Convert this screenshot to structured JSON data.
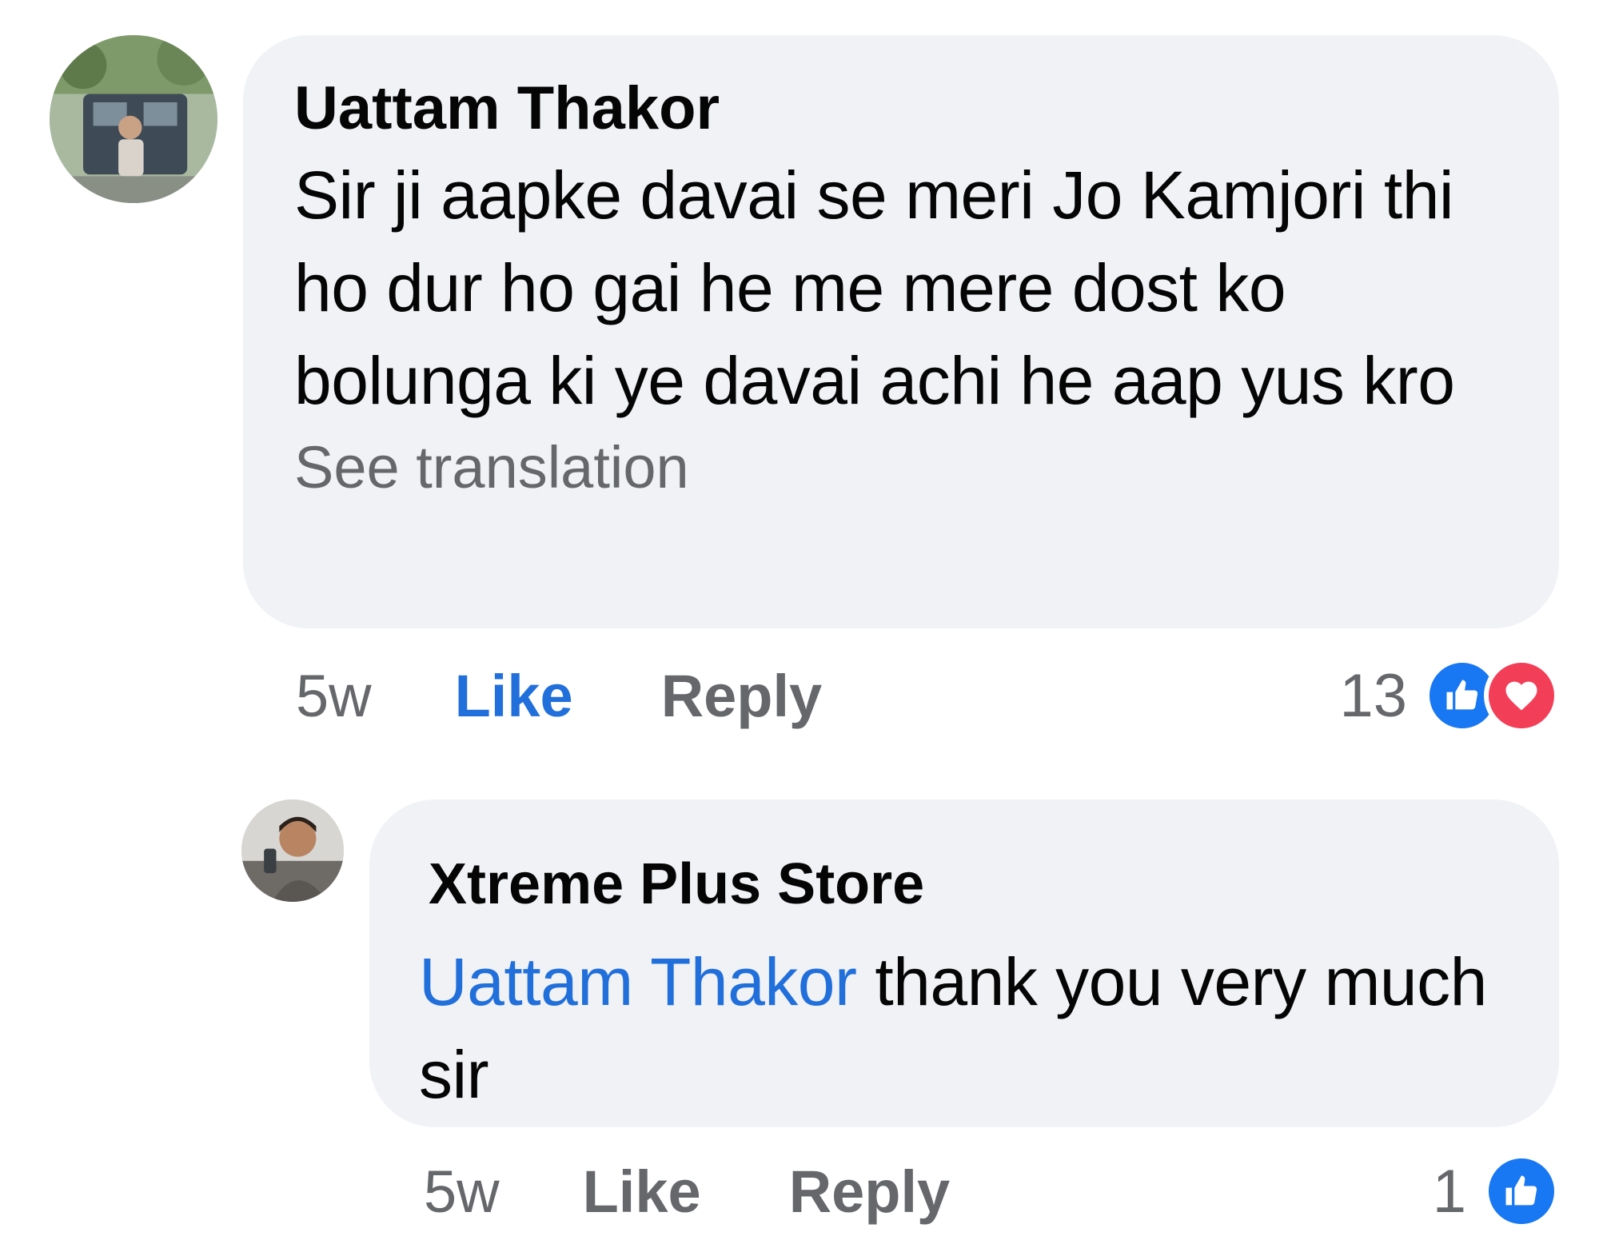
{
  "comments": [
    {
      "author": "Uattam Thakor",
      "text": "Sir ji aapke davai se meri Jo Kamjori thi ho dur ho gai he me mere dost ko bolunga ki ye davai achi he aap yus kro",
      "see_translation": "See translation",
      "time": "5w",
      "like_label": "Like",
      "reply_label": "Reply",
      "reaction_count": "13",
      "reactions": [
        "like-icon",
        "love-icon"
      ]
    },
    {
      "author": "Xtreme Plus Store",
      "mention": "Uattam Thakor",
      "text": " thank you very much sir",
      "time": "5w",
      "like_label": "Like",
      "reply_label": "Reply",
      "reaction_count": "1",
      "reactions": [
        "like-icon"
      ]
    }
  ],
  "colors": {
    "bubble_bg": "#f0f2f5",
    "link_blue": "#216fdb",
    "secondary_text": "#65676b",
    "like_blue": "#1877f2",
    "love_red": "#f33e58"
  }
}
